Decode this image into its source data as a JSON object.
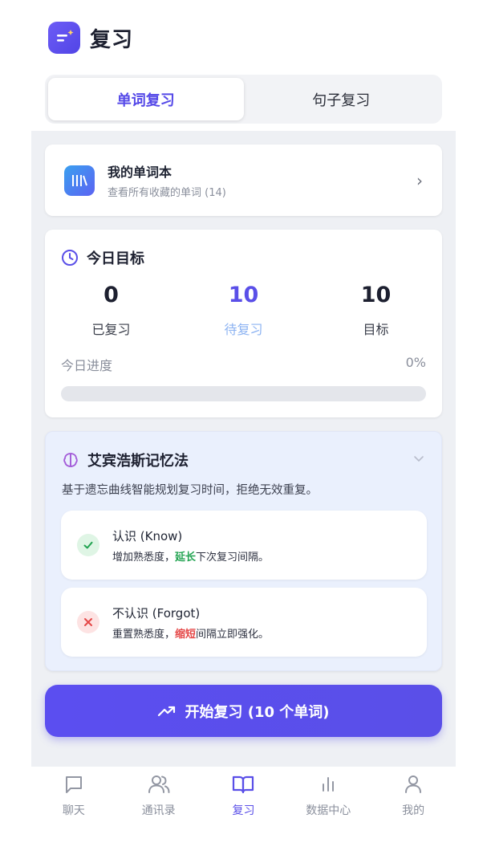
{
  "header": {
    "title": "复习",
    "logo_icon": "review-app-icon"
  },
  "tabs": [
    {
      "label": "单词复习",
      "active": true
    },
    {
      "label": "句子复习",
      "active": false
    }
  ],
  "vocab_book": {
    "title": "我的单词本",
    "subtitle": "查看所有收藏的单词 (14)",
    "chevron": "›"
  },
  "daily_goal": {
    "title": "今日目标",
    "stats": [
      {
        "value": "0",
        "label": "已复习"
      },
      {
        "value": "10",
        "label": "待复习"
      },
      {
        "value": "10",
        "label": "目标"
      }
    ],
    "progress_label": "今日进度",
    "progress_value": "0%",
    "progress_fraction": 0
  },
  "ebbinghaus": {
    "title": "艾宾浩斯记忆法",
    "description": "基于遗忘曲线智能规划复习时间，拒绝无效重复。",
    "know": {
      "title": "认识 (Know)",
      "desc_prefix": "增加熟悉度，",
      "desc_highlight": "延长",
      "desc_suffix": "下次复习间隔。"
    },
    "forgot": {
      "title": "不认识 (Forgot)",
      "desc_prefix": "重置熟悉度，",
      "desc_highlight": "缩短",
      "desc_suffix": "间隔立即强化。"
    }
  },
  "start_button": {
    "label": "开始复习 (10 个单词)"
  },
  "bottom_nav": [
    {
      "label": "聊天",
      "icon": "chat-icon",
      "active": false
    },
    {
      "label": "通讯录",
      "icon": "contacts-icon",
      "active": false
    },
    {
      "label": "复习",
      "icon": "book-icon",
      "active": true
    },
    {
      "label": "数据中心",
      "icon": "stats-icon",
      "active": false
    },
    {
      "label": "我的",
      "icon": "profile-icon",
      "active": false
    }
  ],
  "colors": {
    "accent": "#5a4fe8",
    "pending_label": "#8eb4f2",
    "know_green": "#22a351",
    "forgot_red": "#e54848",
    "panel_bg": "#eef0f4"
  }
}
